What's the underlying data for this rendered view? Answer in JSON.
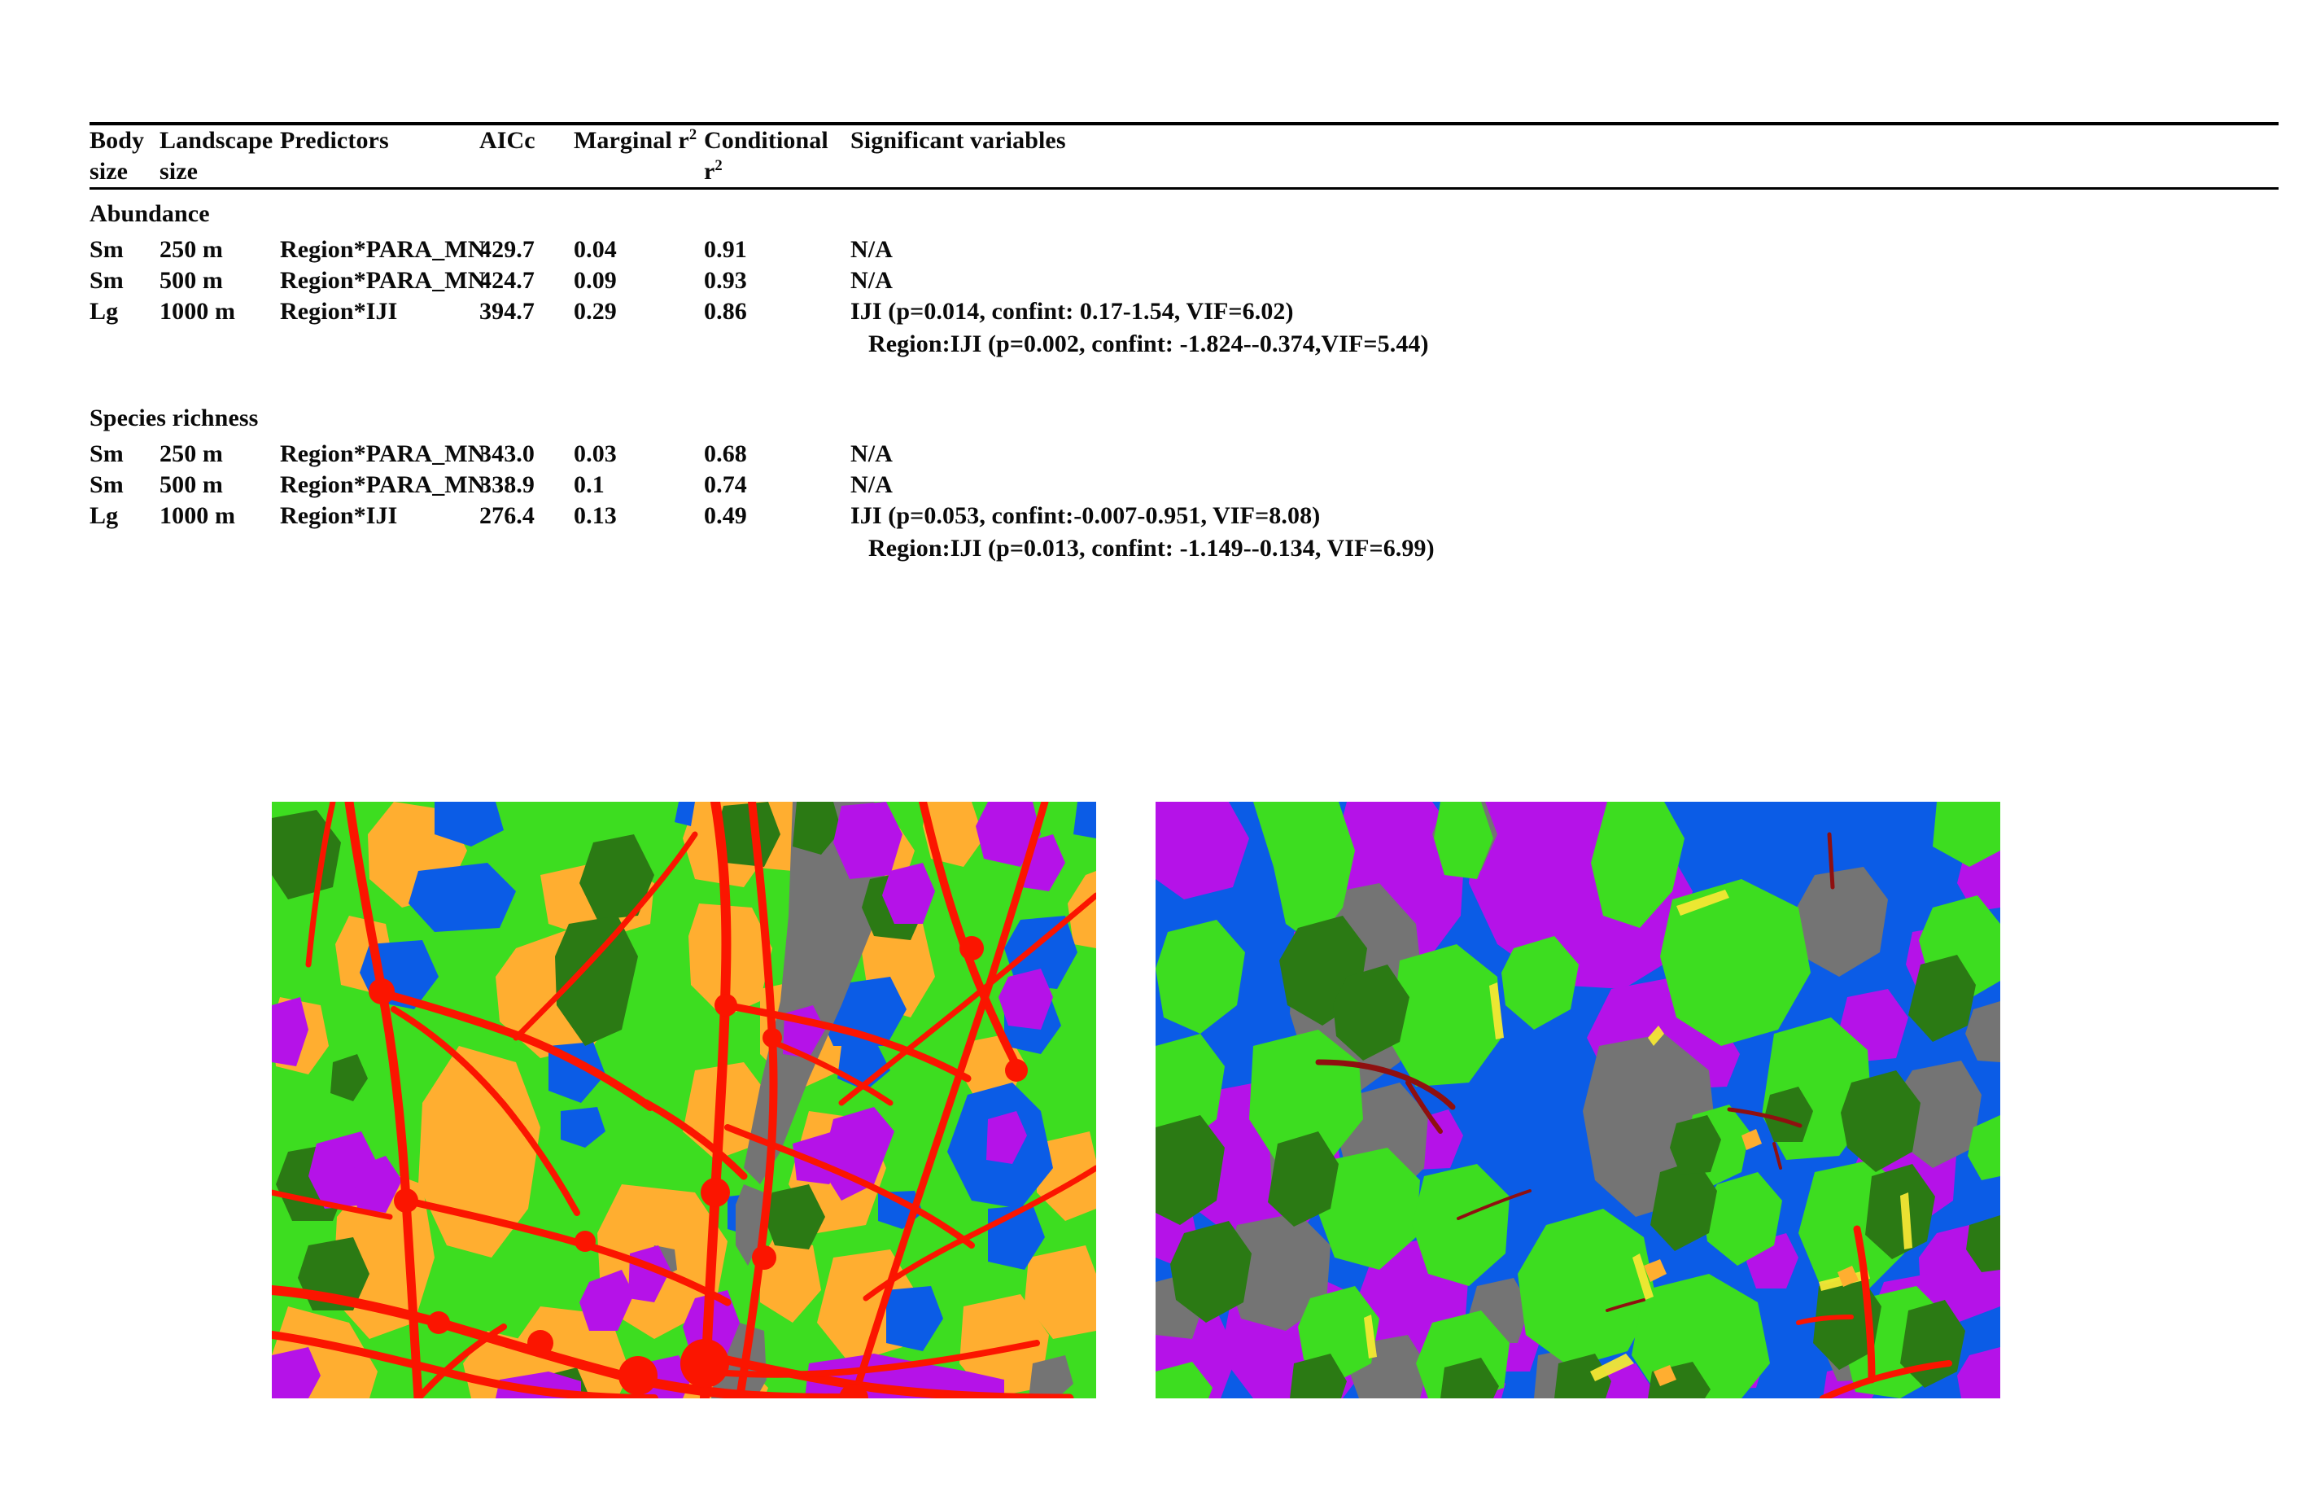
{
  "table": {
    "headers": {
      "body_size_l1": "Body",
      "body_size_l2": "size",
      "landscape_size_l1": "Landscape",
      "landscape_size_l2": "size",
      "predictors": "Predictors",
      "aicc": "AICc",
      "marginal_r2_text": "Marginal r",
      "marginal_r2_sup": "2",
      "conditional_r2_text": "Conditional r",
      "conditional_r2_sup": "2",
      "significant_variables": "Significant variables"
    },
    "sections": [
      {
        "title": "Abundance",
        "rows": [
          {
            "body_size": "Sm",
            "landscape_size": "250 m",
            "predictors": "Region*PARA_MN",
            "aicc": "429.7",
            "marginal_r2": "0.04",
            "conditional_r2": "0.91",
            "significant_variables": "N/A",
            "significant_variables_line2": ""
          },
          {
            "body_size": "Sm",
            "landscape_size": "500 m",
            "predictors": "Region*PARA_MN",
            "aicc": "424.7",
            "marginal_r2": "0.09",
            "conditional_r2": "0.93",
            "significant_variables": "N/A",
            "significant_variables_line2": ""
          },
          {
            "body_size": "Lg",
            "landscape_size": "1000 m",
            "predictors": "Region*IJI",
            "aicc": "394.7",
            "marginal_r2": "0.29",
            "conditional_r2": "0.86",
            "significant_variables": "IJI (p=0.014, confint: 0.17-1.54, VIF=6.02)",
            "significant_variables_line2": "Region:IJI (p=0.002, confint: -1.824--0.374,VIF=5.44)"
          }
        ]
      },
      {
        "title": "Species richness",
        "rows": [
          {
            "body_size": "Sm",
            "landscape_size": "250 m",
            "predictors": "Region*PARA_MN",
            "aicc": "343.0",
            "marginal_r2": "0.03",
            "conditional_r2": "0.68",
            "significant_variables": "N/A",
            "significant_variables_line2": ""
          },
          {
            "body_size": "Sm",
            "landscape_size": "500 m",
            "predictors": "Region*PARA_MN",
            "aicc": "338.9",
            "marginal_r2": "0.1",
            "conditional_r2": "0.74",
            "significant_variables": "N/A",
            "significant_variables_line2": ""
          },
          {
            "body_size": "Lg",
            "landscape_size": "1000 m",
            "predictors": "Region*IJI",
            "aicc": "276.4",
            "marginal_r2": "0.13",
            "conditional_r2": "0.49",
            "significant_variables": "IJI (p=0.053, confint:-0.007-0.951, VIF=8.08)",
            "significant_variables_line2": "Region:IJI (p=0.013, confint: -1.149--0.134, VIF=6.99)"
          }
        ]
      }
    ]
  },
  "figures": {
    "left_map": {
      "name": "land-cover-map-agricultural-region",
      "description": "Classified land cover raster: bright green matrix with large orange agricultural patches, dense red road network, blue water bodies, elongated grey urban corridor upper right, dark green forest patches, scattered magenta developed areas",
      "dominant_classes": [
        "green",
        "orange",
        "red",
        "blue",
        "grey",
        "dark-green",
        "magenta"
      ]
    },
    "right_map": {
      "name": "land-cover-map-lake-region",
      "description": "Classified land cover raster: large blue lake occupying the centre, extensive magenta class, bright green edges, grey patches and dark green forest, very sparse red roads",
      "dominant_classes": [
        "blue",
        "magenta",
        "green",
        "grey",
        "dark-green",
        "red"
      ]
    }
  },
  "colors": {
    "green": "#3ddd20",
    "dark_green": "#2b7a14",
    "orange": "#ffae30",
    "red": "#fb1500",
    "blue": "#0b5ce6",
    "grey": "#747474",
    "magenta": "#b512e8",
    "yellow": "#f4e734",
    "dark_red": "#8f1010",
    "background": "#ffffff",
    "rule": "#000000",
    "text": "#0a0a0a"
  }
}
